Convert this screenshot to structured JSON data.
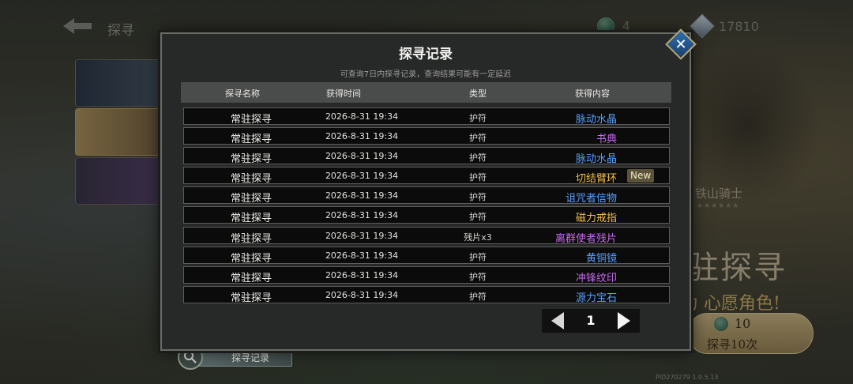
{
  "top": {
    "title": "探寻",
    "currency1": "4",
    "currency2": "17810"
  },
  "hero": {
    "name": "铁山骑士",
    "banner": "驻探寻",
    "wish": "为 心愿角色!",
    "pull10_cost": "10",
    "pull10_label": "探寻10次"
  },
  "version": "PID270279  1.0.5.13",
  "record_tab": "探寻记录",
  "modal": {
    "title": "探寻记录",
    "subtitle": "可查询7日内探寻记录，查询结果可能有一定延迟",
    "close_icon": "close-icon",
    "columns": [
      "探寻名称",
      "获得时间",
      "类型",
      "获得内容"
    ],
    "rows": [
      {
        "name": "常驻探寻",
        "time": "2026-8-31 19:34",
        "type": "护符",
        "item": "脉动水晶",
        "color": "#5aa0ff"
      },
      {
        "name": "常驻探寻",
        "time": "2026-8-31 19:34",
        "type": "护符",
        "item": "书典",
        "color": "#c86af0"
      },
      {
        "name": "常驻探寻",
        "time": "2026-8-31 19:34",
        "type": "护符",
        "item": "脉动水晶",
        "color": "#5aa0ff"
      },
      {
        "name": "常驻探寻",
        "time": "2026-8-31 19:34",
        "type": "护符",
        "item": "切结臂环",
        "color": "#f2c04a",
        "badge": "New"
      },
      {
        "name": "常驻探寻",
        "time": "2026-8-31 19:34",
        "type": "护符",
        "item": "诅咒者信物",
        "color": "#5aa0ff"
      },
      {
        "name": "常驻探寻",
        "time": "2026-8-31 19:34",
        "type": "护符",
        "item": "磁力戒指",
        "color": "#f2c04a"
      },
      {
        "name": "常驻探寻",
        "time": "2026-8-31 19:34",
        "type": "残片x3",
        "item": "离群使者残片",
        "color": "#c86af0"
      },
      {
        "name": "常驻探寻",
        "time": "2026-8-31 19:34",
        "type": "护符",
        "item": "黄铜镜",
        "color": "#5aa0ff"
      },
      {
        "name": "常驻探寻",
        "time": "2026-8-31 19:34",
        "type": "护符",
        "item": "冲锋纹印",
        "color": "#c86af0"
      },
      {
        "name": "常驻探寻",
        "time": "2026-8-31 19:34",
        "type": "护符",
        "item": "源力宝石",
        "color": "#5aa0ff"
      }
    ],
    "page": "1"
  }
}
